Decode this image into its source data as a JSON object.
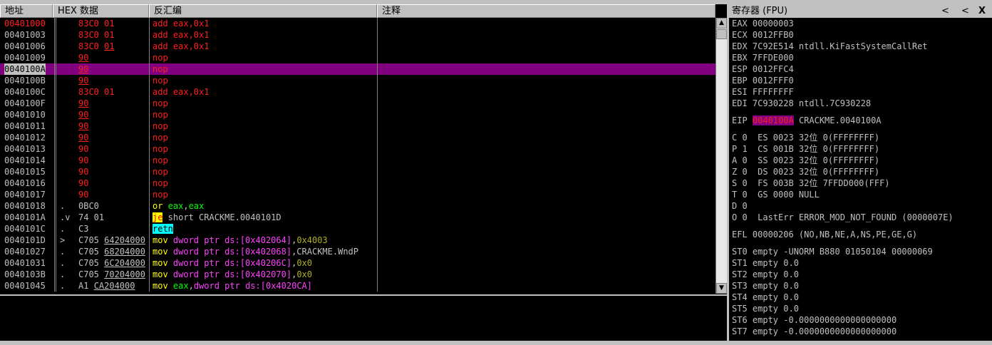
{
  "cpu": {
    "headers": {
      "addr": "地址",
      "hex": "HEX 数据",
      "dis": "反汇编",
      "comment": "注释"
    },
    "rows": [
      {
        "addr": "00401000",
        "hex": "83C0 01",
        "hex_b": "",
        "dis": "add eax,0x1",
        "style": "red"
      },
      {
        "addr": "00401003",
        "hex": "83C0 01",
        "hex_b": "",
        "dis": "add eax,0x1",
        "style": "red"
      },
      {
        "addr": "00401006",
        "hex": "83C0 ",
        "hex_b": "01",
        "dis": "add eax,0x1",
        "style": "red"
      },
      {
        "addr": "00401009",
        "hex": "",
        "hex_b": "90",
        "dis": "nop",
        "style": "red"
      },
      {
        "addr": "0040100A",
        "hex": "",
        "hex_b": "90",
        "dis": "nop",
        "style": "red"
      },
      {
        "addr": "0040100B",
        "hex": "",
        "hex_b": "90",
        "dis": "nop",
        "style": "red"
      },
      {
        "addr": "0040100C",
        "hex": "83C0 01",
        "hex_b": "",
        "dis": "add eax,0x1",
        "style": "red"
      },
      {
        "addr": "0040100F",
        "hex": "",
        "hex_b": "90",
        "dis": "nop",
        "style": "red"
      },
      {
        "addr": "00401010",
        "hex": "",
        "hex_b": "90",
        "dis": "nop",
        "style": "red"
      },
      {
        "addr": "00401011",
        "hex": "",
        "hex_b": "90",
        "dis": "nop",
        "style": "red"
      },
      {
        "addr": "00401012",
        "hex": "",
        "hex_b": "90",
        "dis": "nop",
        "style": "red"
      },
      {
        "addr": "00401013",
        "hex": "90",
        "hex_b": "",
        "dis": "nop",
        "style": "red"
      },
      {
        "addr": "00401014",
        "hex": "90",
        "hex_b": "",
        "dis": "nop",
        "style": "red"
      },
      {
        "addr": "00401015",
        "hex": "90",
        "hex_b": "",
        "dis": "nop",
        "style": "red"
      },
      {
        "addr": "00401016",
        "hex": "90",
        "hex_b": "",
        "dis": "nop",
        "style": "red"
      },
      {
        "addr": "00401017",
        "hex": "90",
        "hex_b": "",
        "dis": "nop",
        "style": "red"
      },
      {
        "addr": "00401018",
        "mark": ".",
        "hex": "0BC0",
        "hex_b": "",
        "dis_parts": [
          [
            "or ",
            "yellow"
          ],
          [
            "eax",
            "green"
          ],
          [
            ",",
            "grey"
          ],
          [
            "eax",
            "green"
          ]
        ],
        "style": "grey"
      },
      {
        "addr": "0040101A",
        "mark": ".v",
        "hex": "74 01",
        "hex_b": "",
        "dis_parts": [
          [
            "je",
            "jebg"
          ],
          [
            " short CRACKME.0040101D",
            "grey"
          ]
        ],
        "style": "grey"
      },
      {
        "addr": "0040101C",
        "mark": ".",
        "hex": "C3",
        "hex_b": "",
        "dis_parts": [
          [
            "retn",
            "retbg"
          ]
        ],
        "style": "grey"
      },
      {
        "addr": "0040101D",
        "mark": ">",
        "hex": "C705 ",
        "hex_b": "64204000",
        "dis_parts": [
          [
            "mov ",
            "yellow"
          ],
          [
            "dword ptr ds:[0x402064]",
            "magenta"
          ],
          [
            ",",
            "grey"
          ],
          [
            "0x4003",
            "olive"
          ]
        ],
        "style": "grey"
      },
      {
        "addr": "00401027",
        "mark": ".",
        "hex": "C705 ",
        "hex_b": "68204000",
        "dis_parts": [
          [
            "mov ",
            "yellow"
          ],
          [
            "dword ptr ds:[0x402068]",
            "magenta"
          ],
          [
            ",CRACKME.WndP",
            "grey"
          ]
        ],
        "style": "grey"
      },
      {
        "addr": "00401031",
        "mark": ".",
        "hex": "C705 ",
        "hex_b": "6C204000",
        "dis_parts": [
          [
            "mov ",
            "yellow"
          ],
          [
            "dword ptr ds:[0x40206C]",
            "magenta"
          ],
          [
            ",",
            "grey"
          ],
          [
            "0x0",
            "olive"
          ]
        ],
        "style": "grey"
      },
      {
        "addr": "0040103B",
        "mark": ".",
        "hex": "C705 ",
        "hex_b": "70204000",
        "dis_parts": [
          [
            "mov ",
            "yellow"
          ],
          [
            "dword ptr ds:[0x402070]",
            "magenta"
          ],
          [
            ",",
            "grey"
          ],
          [
            "0x0",
            "olive"
          ]
        ],
        "style": "grey"
      },
      {
        "addr": "00401045",
        "mark": ".",
        "hex": "A1 ",
        "hex_b": "CA204000",
        "dis_parts": [
          [
            "mov ",
            "yellow"
          ],
          [
            "eax",
            "green"
          ],
          [
            ",",
            "grey"
          ],
          [
            "dword ptr ds:[0x4020CA]",
            "magenta"
          ]
        ],
        "style": "grey"
      }
    ]
  },
  "registers": {
    "title": "寄存器 (FPU)",
    "nav_left": "<",
    "nav_right": "<",
    "close": "X",
    "lines": [
      "EAX 00000003",
      "ECX 0012FFB0",
      "EDX 7C92E514 ntdll.KiFastSystemCallRet",
      "EBX 7FFDE000",
      "ESP 0012FFC4",
      "EBP 0012FFF0",
      "ESI FFFFFFFF",
      "EDI 7C930228 ntdll.7C930228"
    ],
    "eip_label": "EIP",
    "eip_value": "0040100A",
    "eip_desc": "CRACKME.0040100A",
    "flags": [
      "C 0  ES 0023 32位 0(FFFFFFFF)",
      "P 1  CS 001B 32位 0(FFFFFFFF)",
      "A 0  SS 0023 32位 0(FFFFFFFF)",
      "Z 0  DS 0023 32位 0(FFFFFFFF)",
      "S 0  FS 003B 32位 7FFDD000(FFF)",
      "T 0  GS 0000 NULL",
      "D 0",
      "O 0  LastErr ERROR_MOD_NOT_FOUND (0000007E)"
    ],
    "efl": "EFL 00000206 (NO,NB,NE,A,NS,PE,GE,G)",
    "fpu": [
      "ST0 empty -UNORM B880 01050104 00000069",
      "ST1 empty 0.0",
      "ST2 empty 0.0",
      "ST3 empty 0.0",
      "ST4 empty 0.0",
      "ST5 empty 0.0",
      "ST6 empty -0.0000000000000000000",
      "ST7 empty -0.0000000000000000000"
    ]
  }
}
